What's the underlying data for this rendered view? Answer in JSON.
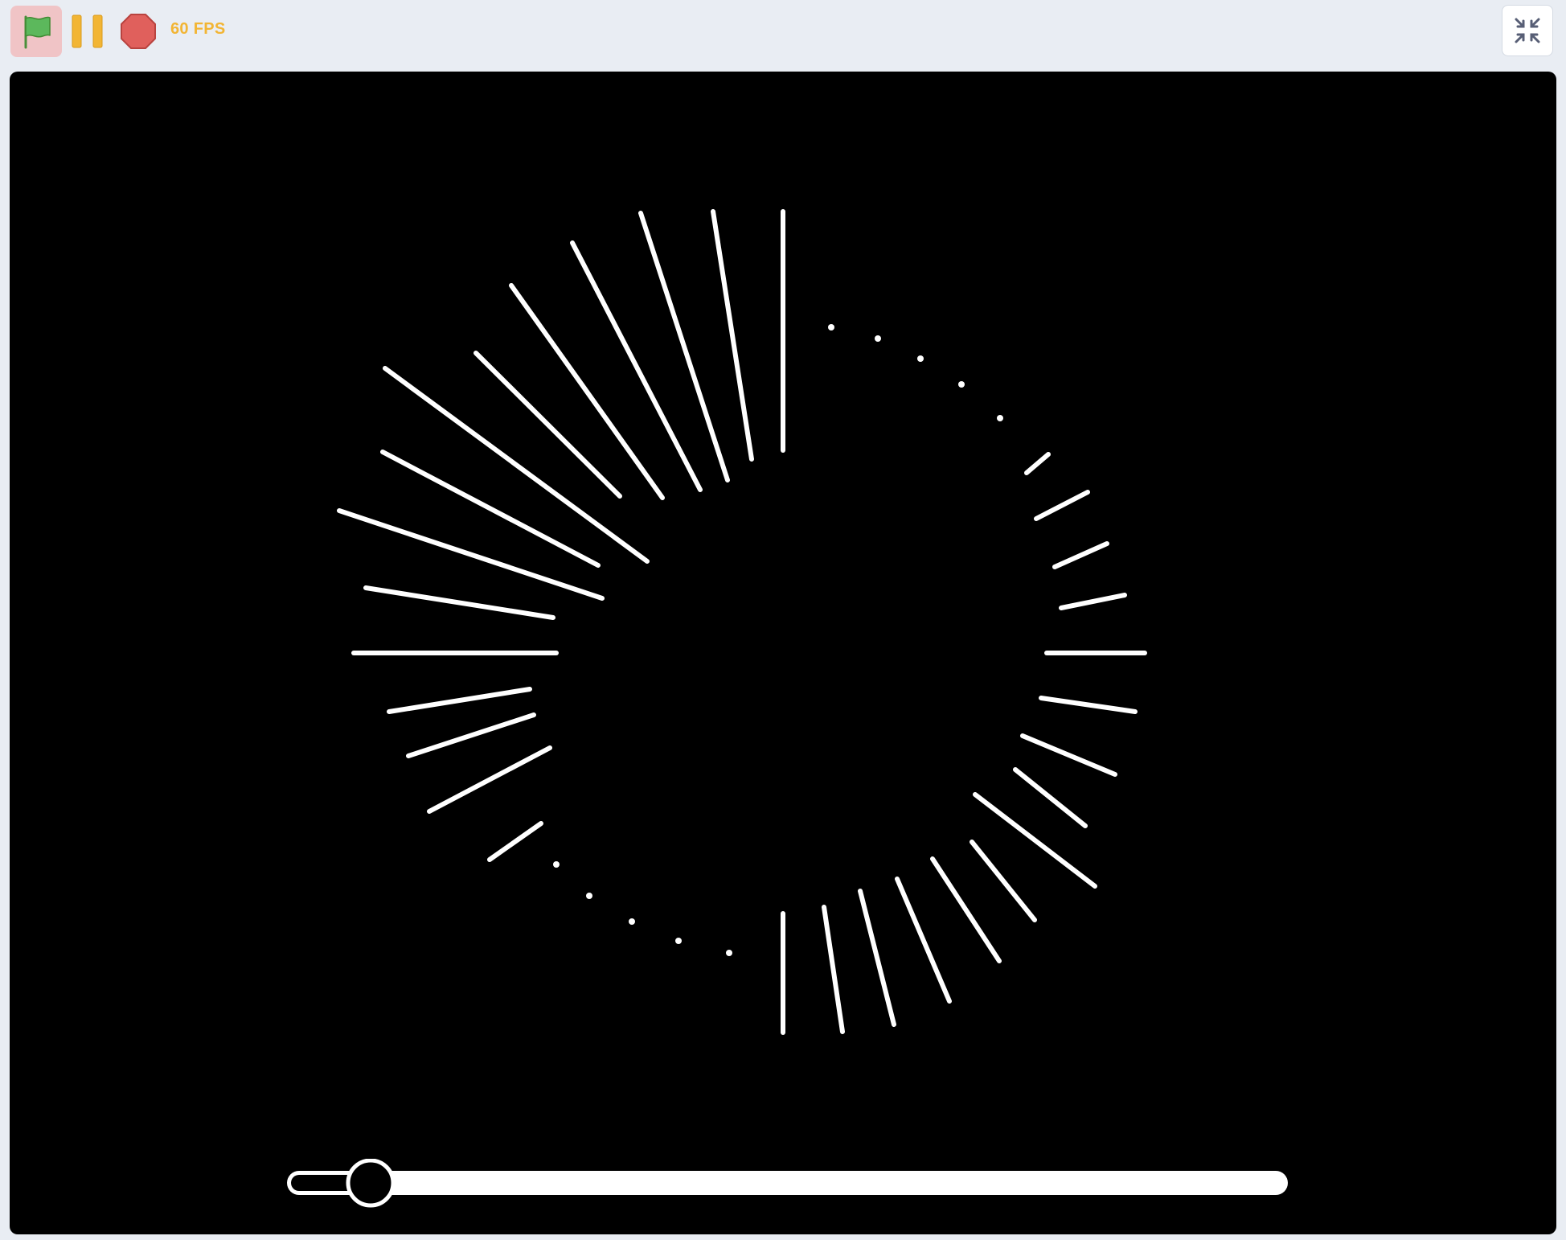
{
  "toolbar": {
    "green_flag": {
      "icon": "green-flag-icon",
      "active": true,
      "bg": "#f0c4c6",
      "flag_color": "#5cb85c"
    },
    "pause": {
      "icon": "pause-icon",
      "color": "#f2b534"
    },
    "stop": {
      "icon": "stop-octagon-icon",
      "color": "#e0605c"
    },
    "fps_label": "60 FPS",
    "fullscreen": {
      "icon": "exit-fullscreen-icon"
    }
  },
  "stage": {
    "background": "#000000",
    "stroke_color": "#ffffff"
  },
  "slider": {
    "value_fraction": 0.085,
    "track_color": "#ffffff",
    "thumb_color": "#000000"
  }
}
